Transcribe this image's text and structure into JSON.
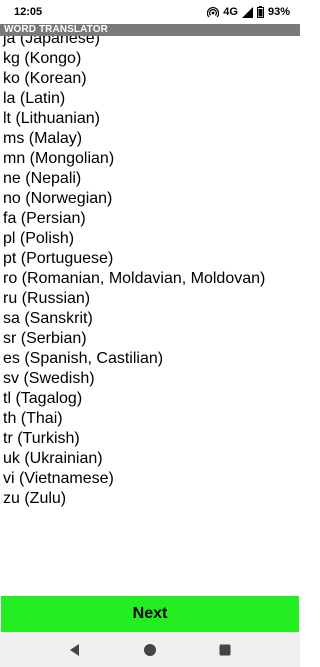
{
  "status_bar": {
    "time": "12:05",
    "network": "4G",
    "battery": "93%",
    "icons": [
      "hotspot-icon",
      "signal-icon",
      "battery-icon"
    ]
  },
  "app_bar": {
    "title": "WORD TRANSLATOR"
  },
  "languages": [
    "ja (Japanese)",
    "kg (Kongo)",
    "ko (Korean)",
    "la (Latin)",
    "lt (Lithuanian)",
    "ms (Malay)",
    "mn (Mongolian)",
    "ne (Nepali)",
    "no (Norwegian)",
    "fa (Persian)",
    "pl (Polish)",
    "pt (Portuguese)",
    "ro (Romanian, Moldavian, Moldovan)",
    "ru (Russian)",
    "sa (Sanskrit)",
    "sr (Serbian)",
    "es (Spanish, Castilian)",
    "sv (Swedish)",
    "tl (Tagalog)",
    "th (Thai)",
    "tr (Turkish)",
    "uk (Ukrainian)",
    "vi (Vietnamese)",
    "zu (Zulu)"
  ],
  "next_button": {
    "label": "Next"
  },
  "nav_bar": {
    "icons": [
      "back-icon",
      "home-icon",
      "recents-icon"
    ]
  },
  "colors": {
    "app_bar": "#7a7a7a",
    "next_button": "#22ee22",
    "nav_bar": "#f0f0f0"
  }
}
